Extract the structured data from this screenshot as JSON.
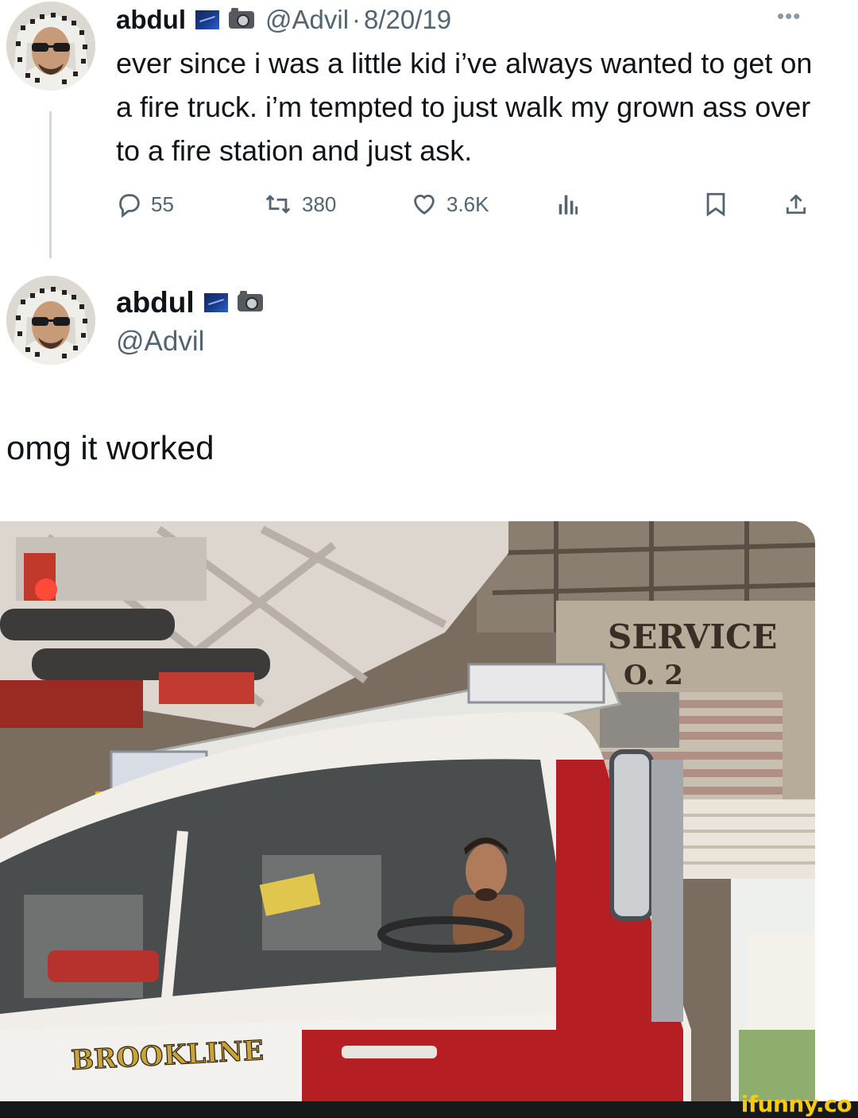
{
  "tweet1": {
    "name": "abdul",
    "handle": "@Advil",
    "separator": "·",
    "date": "8/20/19",
    "text": "ever since i was a little kid i’ve always wanted to get on a fire truck. i’m tempted to just walk my grown ass over to a fire station and just ask.",
    "actions": {
      "replies": "55",
      "retweets": "380",
      "likes": "3.6K"
    }
  },
  "tweet2": {
    "name": "abdul",
    "handle": "@Advil",
    "text": "omg it worked"
  },
  "photo": {
    "sign_line1": "SERVICE",
    "sign_line2": "O. 2",
    "truck_label": "BROOKLINE"
  },
  "watermark": "ifunny.co",
  "colors": {
    "text_primary": "#0f1419",
    "text_secondary": "#536471",
    "thread_line": "#cfd9de",
    "truck_red": "#b51f24",
    "watermark_yellow": "#f6c915"
  },
  "icons": [
    "reply-icon",
    "retweet-icon",
    "like-icon",
    "views-icon",
    "bookmark-icon",
    "share-icon",
    "more-icon",
    "verified-flag-icon",
    "camera-icon"
  ]
}
